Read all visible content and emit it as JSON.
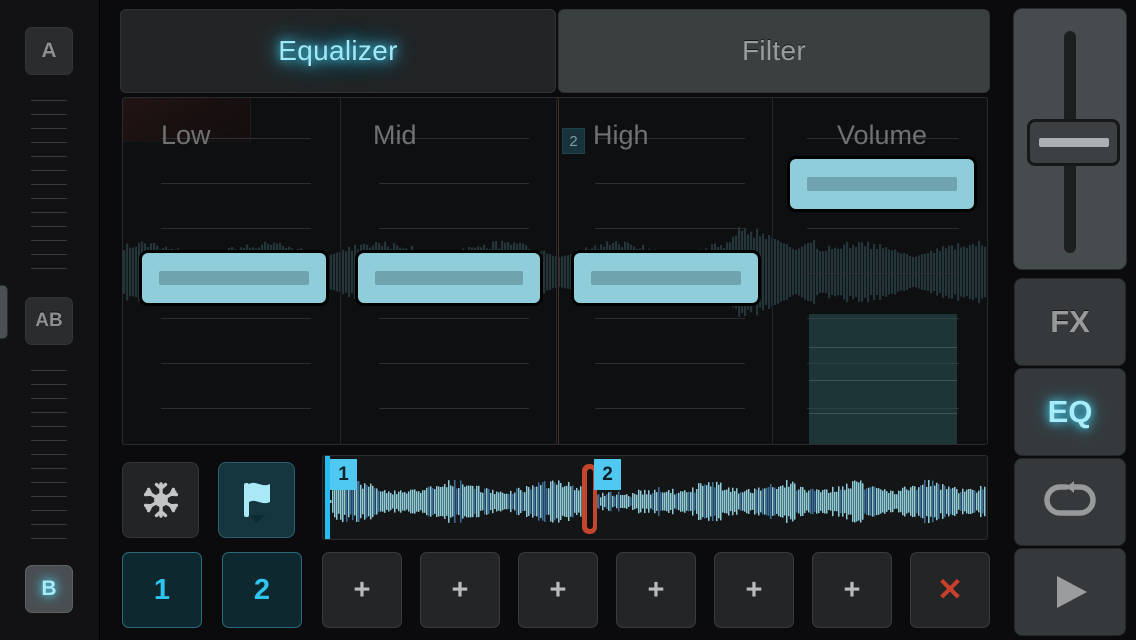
{
  "left_rail": {
    "deck_a_label": "A",
    "crossfade_label": "AB",
    "deck_b_label": "B",
    "edge_handle_name": "drawer-handle",
    "tick_count_top": 13,
    "tick_count_bottom": 13
  },
  "tabs": [
    {
      "id": "equalizer",
      "label": "Equalizer",
      "active": true,
      "color": "#9fe9fa"
    },
    {
      "id": "filter",
      "label": "Filter",
      "active": false,
      "color": "#9a9c9e"
    }
  ],
  "eq_panel": {
    "columns": [
      {
        "id": "low",
        "label": "Low",
        "badge": null,
        "handle_pct": 50
      },
      {
        "id": "mid",
        "label": "Mid",
        "badge": null,
        "handle_pct": 50
      },
      {
        "id": "high",
        "label": "High",
        "badge": "2",
        "handle_pct": 50
      },
      {
        "id": "volume",
        "label": "Volume",
        "badge": null,
        "handle_pct": 72
      }
    ],
    "gridline_count": 8,
    "handle_color": "#8ecdd9",
    "handle_grip_color": "#6fa3ad",
    "volume_fill_color": "#2a4e52"
  },
  "transport": {
    "freeze_button": {
      "name": "freeze-button",
      "icon": "snowflake-icon",
      "active": false
    },
    "cue_flag_button": {
      "name": "cue-flag-button",
      "icon": "flag-icon",
      "active": true
    }
  },
  "waveform": {
    "cue_markers": [
      {
        "label": "1",
        "position_pct": 0.3,
        "color": "#25bdf0"
      },
      {
        "label": "2",
        "position_pct": 39.6,
        "color": "#25bdf0"
      }
    ],
    "playhead": {
      "position_pct": 38.9,
      "color": "#c3452b"
    },
    "wave_color": "#8ecdd9"
  },
  "cue_pads": [
    {
      "label": "1",
      "type": "cue",
      "name": "cue-pad-1"
    },
    {
      "label": "2",
      "type": "cue",
      "name": "cue-pad-2"
    },
    {
      "label": "+",
      "type": "add",
      "name": "add-cue-pad-3"
    },
    {
      "label": "+",
      "type": "add",
      "name": "add-cue-pad-4"
    },
    {
      "label": "+",
      "type": "add",
      "name": "add-cue-pad-5"
    },
    {
      "label": "+",
      "type": "add",
      "name": "add-cue-pad-6"
    },
    {
      "label": "+",
      "type": "add",
      "name": "add-cue-pad-7"
    },
    {
      "label": "+",
      "type": "add",
      "name": "add-cue-pad-8"
    },
    {
      "label": "✕",
      "type": "delete",
      "name": "delete-cue-pad"
    }
  ],
  "right_rail": {
    "fader": {
      "name": "tempo-fader",
      "value_pct": 50
    },
    "buttons": [
      {
        "id": "fx",
        "label": "FX",
        "icon": null,
        "active": false
      },
      {
        "id": "eq",
        "label": "EQ",
        "icon": null,
        "active": true
      },
      {
        "id": "loop",
        "label": "",
        "icon": "loop-icon",
        "active": false
      },
      {
        "id": "play",
        "label": "",
        "icon": "play-icon",
        "active": false
      }
    ]
  },
  "colors": {
    "accent_cyan": "#4fd3ef",
    "accent_cyan_light": "#a6ecfa",
    "handle_cyan": "#8ecdd9",
    "red": "#c8402a",
    "playhead_red": "#c3452b",
    "panel_bg": "#0e0f11",
    "app_bg": "#0b0b0d"
  }
}
